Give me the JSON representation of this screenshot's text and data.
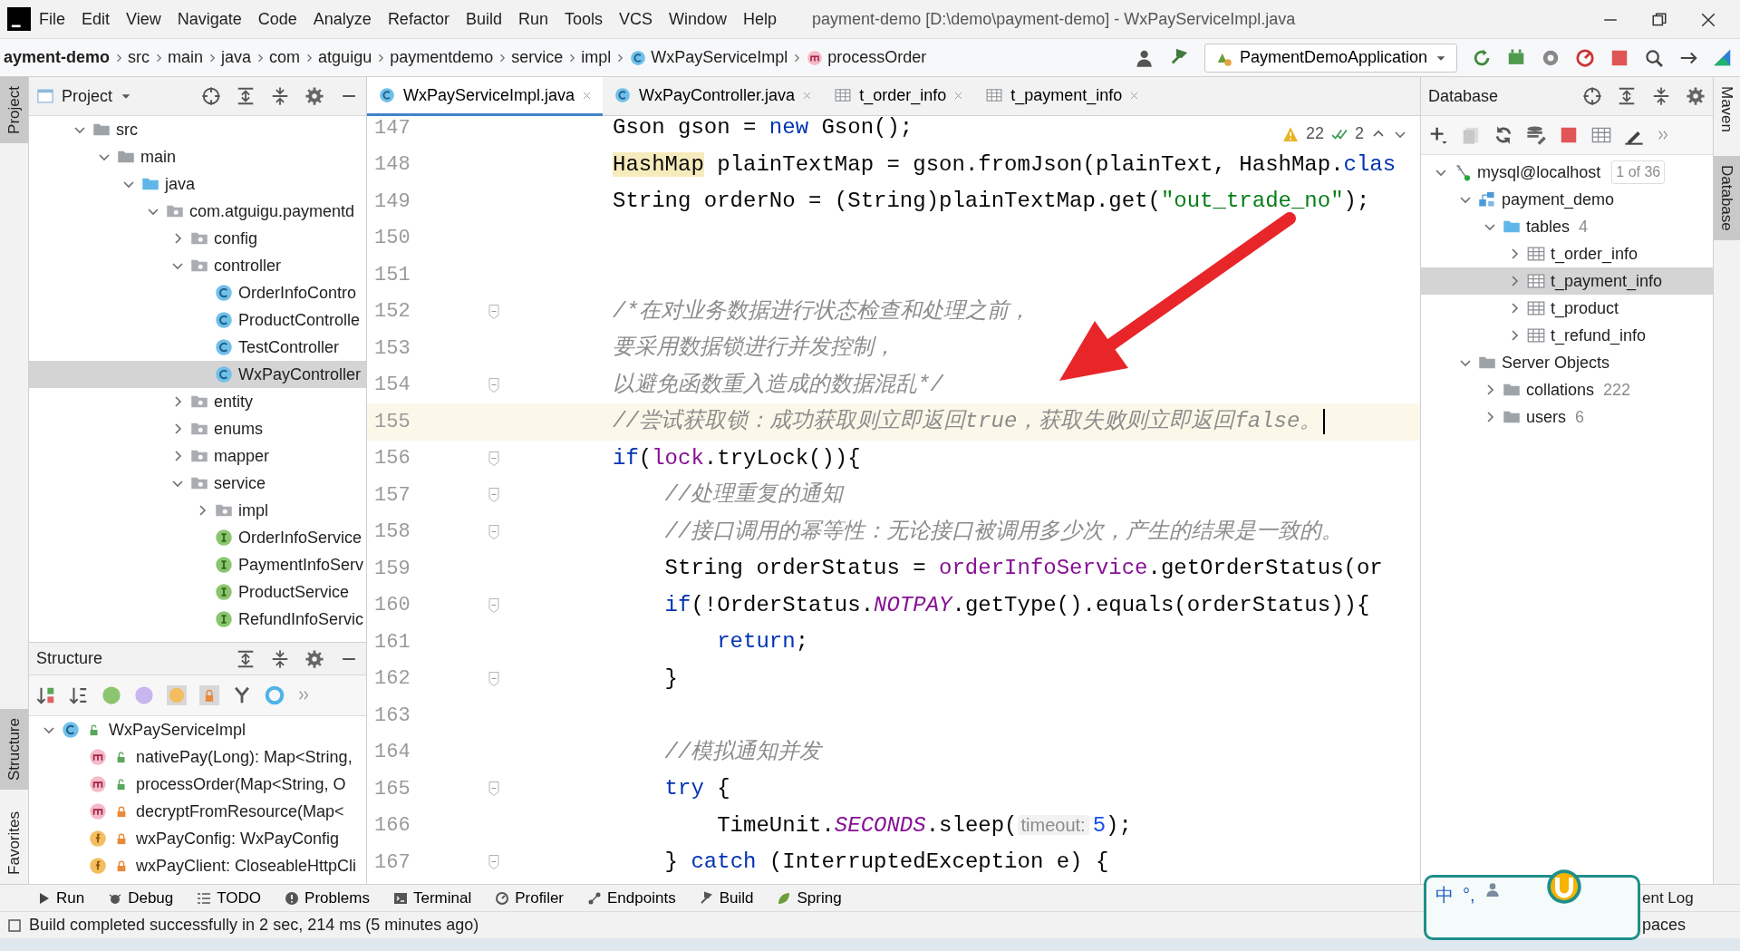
{
  "window": {
    "title": "payment-demo [D:\\demo\\payment-demo] - WxPayServiceImpl.java"
  },
  "menu": [
    "File",
    "Edit",
    "View",
    "Navigate",
    "Code",
    "Analyze",
    "Refactor",
    "Build",
    "Run",
    "Tools",
    "VCS",
    "Window",
    "Help"
  ],
  "breadcrumb": [
    {
      "label": "ayment-demo",
      "kind": "project"
    },
    {
      "label": "src",
      "kind": "dir"
    },
    {
      "label": "main",
      "kind": "dir"
    },
    {
      "label": "java",
      "kind": "dir"
    },
    {
      "label": "com",
      "kind": "dir"
    },
    {
      "label": "atguigu",
      "kind": "dir"
    },
    {
      "label": "paymentdemo",
      "kind": "dir"
    },
    {
      "label": "service",
      "kind": "dir"
    },
    {
      "label": "impl",
      "kind": "dir"
    },
    {
      "label": "WxPayServiceImpl",
      "kind": "class"
    },
    {
      "label": "processOrder",
      "kind": "method"
    }
  ],
  "run_config": "PaymentDemoApplication",
  "left_stripe": [
    {
      "label": "Project",
      "selected": true
    },
    {
      "label": "Structure",
      "selected": true
    },
    {
      "label": "Favorites",
      "selected": false
    }
  ],
  "project_panel": {
    "title": "Project",
    "tree": [
      {
        "label": "src",
        "kind": "folder",
        "expanded": true,
        "selected": false,
        "children": [
          {
            "label": "main",
            "kind": "folder",
            "expanded": true,
            "selected": false,
            "children": [
              {
                "label": "java",
                "kind": "source-folder",
                "expanded": true,
                "selected": false,
                "children": [
                  {
                    "label": "com.atguigu.paymentd",
                    "kind": "package",
                    "expanded": true,
                    "selected": false,
                    "children": [
                      {
                        "label": "config",
                        "kind": "package",
                        "expanded": false,
                        "selected": false
                      },
                      {
                        "label": "controller",
                        "kind": "package",
                        "expanded": true,
                        "selected": false,
                        "children": [
                          {
                            "label": "OrderInfoContro",
                            "kind": "class",
                            "selected": false
                          },
                          {
                            "label": "ProductControlle",
                            "kind": "class",
                            "selected": false
                          },
                          {
                            "label": "TestController",
                            "kind": "class",
                            "selected": false
                          },
                          {
                            "label": "WxPayController",
                            "kind": "class",
                            "selected": true
                          }
                        ]
                      },
                      {
                        "label": "entity",
                        "kind": "package",
                        "expanded": false,
                        "selected": false
                      },
                      {
                        "label": "enums",
                        "kind": "package",
                        "expanded": false,
                        "selected": false
                      },
                      {
                        "label": "mapper",
                        "kind": "package",
                        "expanded": false,
                        "selected": false
                      },
                      {
                        "label": "service",
                        "kind": "package",
                        "expanded": true,
                        "selected": false,
                        "children": [
                          {
                            "label": "impl",
                            "kind": "package",
                            "expanded": false,
                            "selected": false
                          },
                          {
                            "label": "OrderInfoService",
                            "kind": "interface",
                            "selected": false
                          },
                          {
                            "label": "PaymentInfoServ",
                            "kind": "interface",
                            "selected": false
                          },
                          {
                            "label": "ProductService",
                            "kind": "interface",
                            "selected": false
                          },
                          {
                            "label": "RefundInfoServic",
                            "kind": "interface",
                            "selected": false
                          }
                        ]
                      }
                    ]
                  }
                ]
              }
            ]
          }
        ]
      }
    ]
  },
  "structure_panel": {
    "title": "Structure",
    "tree": [
      {
        "label": "WxPayServiceImpl",
        "kind": "class",
        "private": false,
        "expanded": true,
        "selected": false,
        "children": [
          {
            "label": "nativePay(Long): Map<String,",
            "kind": "method",
            "private": false,
            "selected": false
          },
          {
            "label": "processOrder(Map<String, O",
            "kind": "method",
            "private": false,
            "selected": false
          },
          {
            "label": "decryptFromResource(Map<",
            "kind": "method",
            "private": true,
            "selected": false
          },
          {
            "label": "wxPayConfig: WxPayConfig",
            "kind": "field",
            "private": true,
            "selected": false
          },
          {
            "label": "wxPayClient: CloseableHttpCli",
            "kind": "field",
            "private": true,
            "selected": false
          }
        ]
      }
    ]
  },
  "editor": {
    "tabs": [
      {
        "label": "WxPayServiceImpl.java",
        "kind": "class",
        "selected": true
      },
      {
        "label": "WxPayController.java",
        "kind": "class",
        "selected": false
      },
      {
        "label": "t_order_info",
        "kind": "table",
        "selected": false
      },
      {
        "label": "t_payment_info",
        "kind": "table",
        "selected": false
      }
    ],
    "inspections": {
      "warnings": "22",
      "weak_warnings": "2"
    },
    "lines": [
      {
        "no": "147",
        "fold": false,
        "current": false,
        "tokens": [
          {
            "text": "Gson gson = ",
            "kind": "plain"
          },
          {
            "text": "new",
            "kind": "kw"
          },
          {
            "text": " Gson();",
            "kind": "plain"
          }
        ]
      },
      {
        "no": "148",
        "fold": false,
        "current": false,
        "tokens": [
          {
            "text": "HashMap",
            "kind": "hl"
          },
          {
            "text": " plainTextMap = gson.fromJson(plainText, HashMap.",
            "kind": "plain"
          },
          {
            "text": "clas",
            "kind": "kw"
          }
        ]
      },
      {
        "no": "149",
        "fold": false,
        "current": false,
        "tokens": [
          {
            "text": "String orderNo = (String)plainTextMap.get(",
            "kind": "plain"
          },
          {
            "text": "\"out_trade_no\"",
            "kind": "str"
          },
          {
            "text": ");",
            "kind": "plain"
          }
        ]
      },
      {
        "no": "150",
        "fold": false,
        "current": false
      },
      {
        "no": "151",
        "fold": false,
        "current": false
      },
      {
        "no": "152",
        "fold": true,
        "current": false,
        "tokens": [
          {
            "text": "/*在对业务数据进行状态检查和处理之前，",
            "kind": "cmt"
          }
        ]
      },
      {
        "no": "153",
        "fold": false,
        "current": false,
        "tokens": [
          {
            "text": "要采用数据锁进行并发控制，",
            "kind": "cmt"
          }
        ]
      },
      {
        "no": "154",
        "fold": true,
        "current": false,
        "tokens": [
          {
            "text": "以避免函数重入造成的数据混乱*/",
            "kind": "cmt"
          }
        ]
      },
      {
        "no": "155",
        "fold": false,
        "current": true,
        "tokens": [
          {
            "text": "//尝试获取锁：成功获取则立即返回true，获取失败则立即返回false。",
            "kind": "cmt"
          }
        ]
      },
      {
        "no": "156",
        "fold": true,
        "current": false,
        "tokens": [
          {
            "text": "if",
            "kind": "kw"
          },
          {
            "text": "(",
            "kind": "plain"
          },
          {
            "text": "lock",
            "kind": "fld"
          },
          {
            "text": ".tryLock()){",
            "kind": "plain"
          }
        ]
      },
      {
        "no": "157",
        "fold": true,
        "current": false,
        "tokens": [
          {
            "text": "    //处理重复的通知",
            "kind": "cmt"
          }
        ]
      },
      {
        "no": "158",
        "fold": true,
        "current": false,
        "tokens": [
          {
            "text": "    //接口调用的幂等性：无论接口被调用多少次，产生的结果是一致的。",
            "kind": "cmt"
          }
        ]
      },
      {
        "no": "159",
        "fold": false,
        "current": false,
        "tokens": [
          {
            "text": "    String orderStatus = ",
            "kind": "plain"
          },
          {
            "text": "orderInfoService",
            "kind": "fld"
          },
          {
            "text": ".getOrderStatus(or",
            "kind": "plain"
          }
        ]
      },
      {
        "no": "160",
        "fold": true,
        "current": false,
        "tokens": [
          {
            "text": "    if",
            "kind": "kw"
          },
          {
            "text": "(!OrderStatus.",
            "kind": "plain"
          },
          {
            "text": "NOTPAY",
            "kind": "sfld"
          },
          {
            "text": ".getType().equals(orderStatus)){",
            "kind": "plain"
          }
        ]
      },
      {
        "no": "161",
        "fold": false,
        "current": false,
        "tokens": [
          {
            "text": "        return",
            "kind": "kw"
          },
          {
            "text": ";",
            "kind": "plain"
          }
        ]
      },
      {
        "no": "162",
        "fold": true,
        "current": false,
        "tokens": [
          {
            "text": "    }",
            "kind": "plain"
          }
        ]
      },
      {
        "no": "163",
        "fold": false,
        "current": false
      },
      {
        "no": "164",
        "fold": false,
        "current": false,
        "tokens": [
          {
            "text": "    //模拟通知并发",
            "kind": "cmt"
          }
        ]
      },
      {
        "no": "165",
        "fold": true,
        "current": false,
        "tokens": [
          {
            "text": "    try",
            "kind": "kw"
          },
          {
            "text": " {",
            "kind": "plain"
          }
        ]
      },
      {
        "no": "166",
        "fold": false,
        "current": false,
        "tokens": [
          {
            "text": "        TimeUnit.",
            "kind": "plain"
          },
          {
            "text": "SECONDS",
            "kind": "sfld"
          },
          {
            "text": ".sleep(",
            "kind": "plain"
          },
          {
            "text": "timeout:",
            "kind": "hint"
          },
          {
            "text": "5",
            "kind": "num"
          },
          {
            "text": ");",
            "kind": "plain"
          }
        ]
      },
      {
        "no": "167",
        "fold": true,
        "current": false,
        "tokens": [
          {
            "text": "    } ",
            "kind": "plain"
          },
          {
            "text": "catch",
            "kind": "kw"
          },
          {
            "text": " (InterruptedException e) {",
            "kind": "plain"
          }
        ]
      }
    ]
  },
  "database_panel": {
    "title": "Database",
    "tree": [
      {
        "label": "mysql@localhost",
        "kind": "datasource",
        "badge": "1 of 36",
        "expanded": true,
        "selected": false,
        "children": [
          {
            "label": "payment_demo",
            "kind": "schema",
            "expanded": true,
            "selected": false,
            "children": [
              {
                "label": "tables",
                "kind": "source-folder",
                "count": "4",
                "expanded": true,
                "selected": false,
                "children": [
                  {
                    "label": "t_order_info",
                    "kind": "table",
                    "expanded": false,
                    "selected": false
                  },
                  {
                    "label": "t_payment_info",
                    "kind": "table",
                    "expanded": false,
                    "selected": true
                  },
                  {
                    "label": "t_product",
                    "kind": "table",
                    "expanded": false,
                    "selected": false
                  },
                  {
                    "label": "t_refund_info",
                    "kind": "table",
                    "expanded": false,
                    "selected": false
                  }
                ]
              }
            ]
          },
          {
            "label": "Server Objects",
            "kind": "folder",
            "expanded": true,
            "selected": false,
            "children": [
              {
                "label": "collations",
                "kind": "folder",
                "count": "222",
                "expanded": false,
                "selected": false
              },
              {
                "label": "users",
                "kind": "folder",
                "count": "6",
                "expanded": false,
                "selected": false
              }
            ]
          }
        ]
      }
    ]
  },
  "right_stripe": [
    {
      "label": "Maven",
      "selected": false
    },
    {
      "label": "Database",
      "selected": true
    }
  ],
  "bottom_tools": [
    {
      "label": "Run",
      "kind": "run"
    },
    {
      "label": "Debug",
      "kind": "debug"
    },
    {
      "label": "TODO",
      "kind": "todo"
    },
    {
      "label": "Problems",
      "kind": "problems"
    },
    {
      "label": "Terminal",
      "kind": "terminal"
    },
    {
      "label": "Profiler",
      "kind": "profiler"
    },
    {
      "label": "Endpoints",
      "kind": "endpoints"
    },
    {
      "label": "Build",
      "kind": "build"
    },
    {
      "label": "Spring",
      "kind": "spring"
    }
  ],
  "bottom_right": "ent Log",
  "ime": {
    "mode": "中",
    "punct": "°,"
  },
  "status_bar": {
    "message": "Build completed successfully in 2 sec, 214 ms (5 minutes ago)",
    "right": "paces"
  }
}
